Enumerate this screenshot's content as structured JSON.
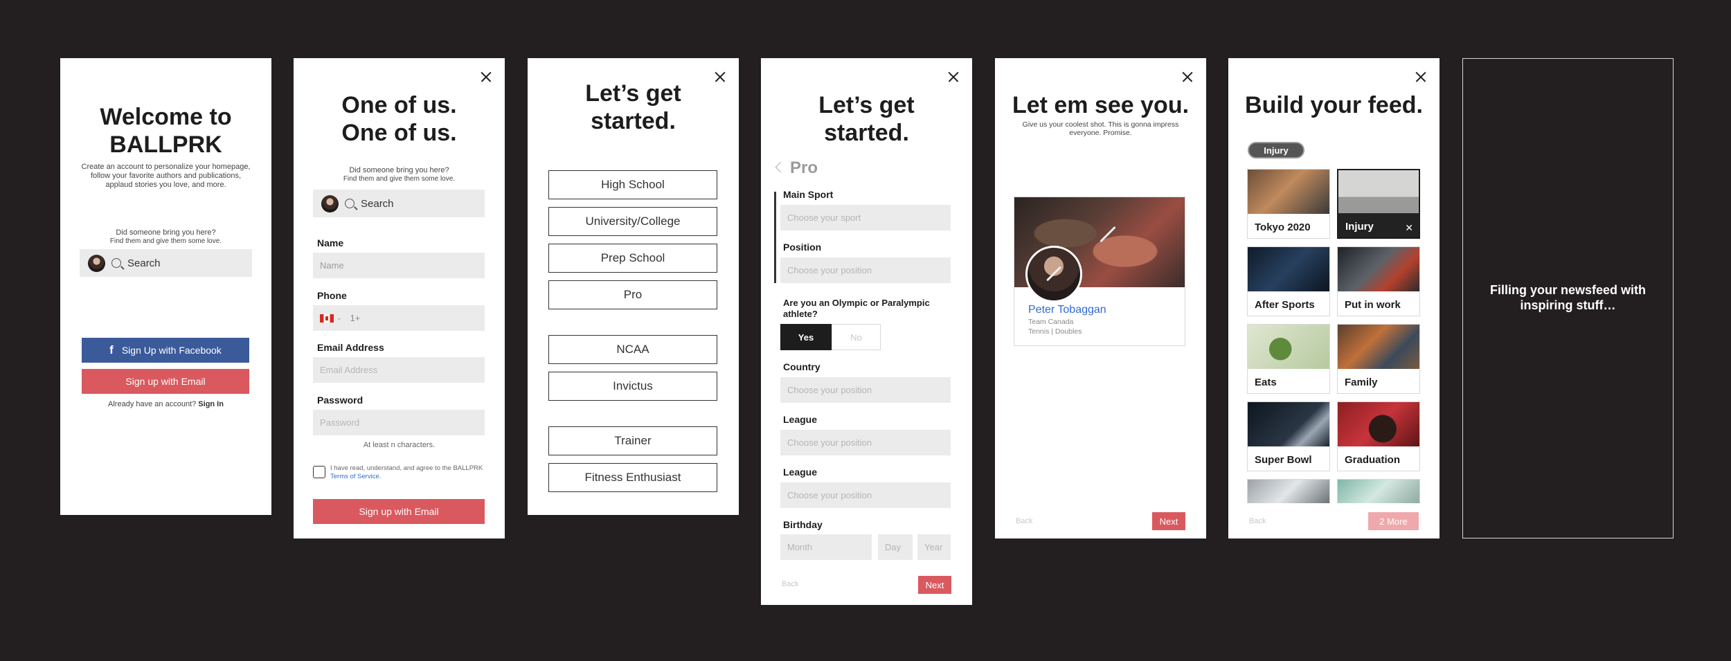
{
  "welcome": {
    "title_line1": "Welcome to",
    "title_line2": "BALLPRK",
    "desc_line1": "Create an account to personalize your homepage,",
    "desc_line2": "follow your favorite authors and publications,",
    "desc_line3": "applaud stories you love, and more.",
    "referral_q": "Did someone bring you here?",
    "referral_hint": "Find them and give them some love.",
    "search_placeholder": "Search",
    "facebook_label": "Sign Up with Facebook",
    "email_label": "Sign up with Email",
    "have_account": "Already have an account?",
    "sign_in": "Sign In"
  },
  "signup": {
    "title_line1": "One of us.",
    "title_line2": "One of us.",
    "referral_q": "Did someone bring you here?",
    "referral_hint": "Find them and give them some love.",
    "search_placeholder": "Search",
    "name_label": "Name",
    "name_placeholder": "Name",
    "phone_label": "Phone",
    "phone_code": "1+",
    "email_label": "Email Address",
    "email_placeholder": "Email Address",
    "password_label": "Password",
    "password_placeholder": "Password",
    "password_hint": "At least n characters.",
    "terms_text": "I have read, understand, and agree to the BALLPRK",
    "terms_link": "Terms of Service.",
    "submit_label": "Sign up with Email"
  },
  "start": {
    "title_line1": "Let’s get",
    "title_line2": "started.",
    "options": [
      "High School",
      "University/College",
      "Prep School",
      "Pro",
      "NCAA",
      "Invictus",
      "Trainer",
      "Fitness Enthusiast"
    ]
  },
  "pro": {
    "title_line1": "Let’s get",
    "title_line2": "started.",
    "section": "Pro",
    "main_sport_label": "Main Sport",
    "main_sport_placeholder": "Choose your sport",
    "position_label": "Position",
    "position_placeholder": "Choose your position",
    "olympic_q_line1": "Are you an Olympic or Paralympic",
    "olympic_q_line2": "athlete?",
    "yes": "Yes",
    "no": "No",
    "country_label": "Country",
    "country_placeholder": "Choose your position",
    "league1_label": "League",
    "league1_placeholder": "Choose your position",
    "league2_label": "League",
    "league2_placeholder": "Choose your position",
    "birthday_label": "Birthday",
    "month": "Month",
    "day": "Day",
    "year": "Year",
    "back": "Back",
    "next": "Next"
  },
  "photo": {
    "title": "Let em see you.",
    "sub_line1": "Give us your coolest shot. This is gonna impress",
    "sub_line2": "everyone. Promise.",
    "name": "Peter Tobaggan",
    "team": "Team Canada",
    "sport": "Tennis | Doubles",
    "back": "Back",
    "next": "Next"
  },
  "feed": {
    "title": "Build your feed.",
    "chip": "Injury",
    "tiles": [
      "Tokyo 2020",
      "Injury",
      "After Sports",
      "Put in work",
      "Eats",
      "Family",
      "Super Bowl",
      "Graduation"
    ],
    "back": "Back",
    "more": "2 More"
  },
  "loading": {
    "line1": "Filling your newsfeed with",
    "line2": "inspiring stuff…"
  },
  "colors": {
    "background": "#231f20",
    "facebook": "#3b5a9a",
    "accent_red": "#d9595f",
    "link_blue": "#2e6bd1",
    "field": "#ebebeb"
  }
}
